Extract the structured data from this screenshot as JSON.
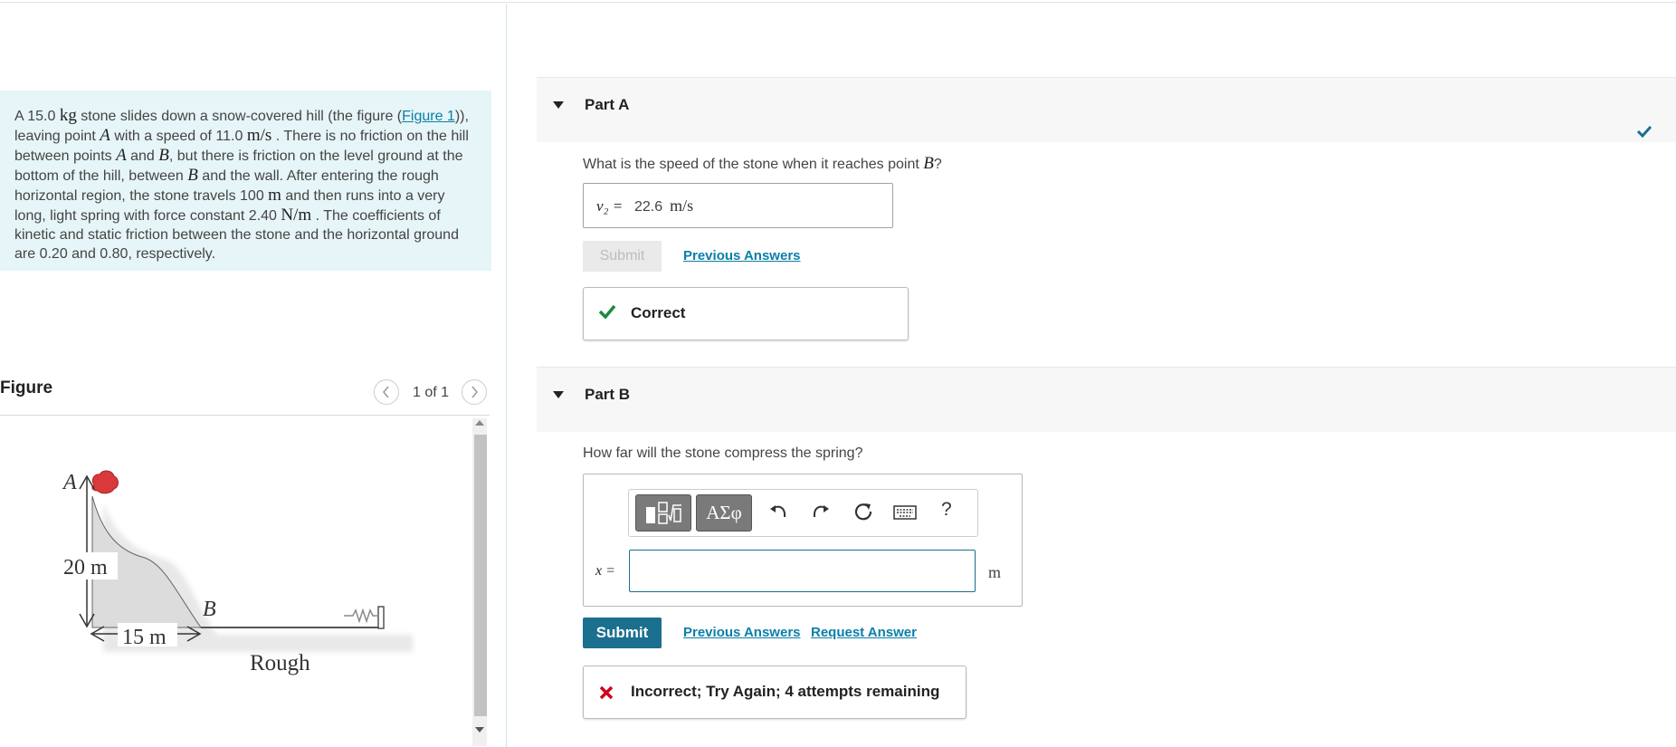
{
  "problem": {
    "t1": "A 15.0 ",
    "kg": "kg",
    "t2": " stone slides down a snow-covered hill (the figure (",
    "figure_link": "Figure 1",
    "t3": ")), leaving point ",
    "A": "A",
    "t4": " with a speed of 11.0 ",
    "ms": "m/s",
    "t5": " . There is no friction on the hill between points ",
    "A2": "A",
    "t6": " and ",
    "B": "B",
    "t7": ", but there is friction on the level ground at the bottom of the hill, between ",
    "B2": "B",
    "t8": " and the wall. After entering the rough horizontal region, the stone travels 100 ",
    "m": "m",
    "t9": " and then runs into a very long, light spring with force constant 2.40 ",
    "Nm": "N/m",
    "t10": " . The coefficients of kinetic and static friction between the stone and the horizontal ground are 0.20 and 0.80, respectively."
  },
  "figure": {
    "title": "Figure",
    "pager": "1 of 1",
    "label_A": "A",
    "label_height": "20 m",
    "label_B": "B",
    "label_width": "15 m",
    "label_rough": "Rough"
  },
  "partA": {
    "title": "Part A",
    "question_pre": "What is the speed of the stone when it reaches point ",
    "question_var": "B",
    "question_post": "?",
    "answer_label": "v₂ =",
    "answer_value": "22.6",
    "answer_unit": "m/s",
    "submit_label": "Submit",
    "prev_answers": "Previous Answers",
    "feedback": "Correct"
  },
  "partB": {
    "title": "Part B",
    "question": "How far will the stone compress the spring?",
    "toolbar_greek": "ΑΣφ",
    "toolbar_help": "?",
    "input_label": "x =",
    "input_unit": "m",
    "submit_label": "Submit",
    "prev_answers": "Previous Answers",
    "request_answer": "Request Answer",
    "feedback": "Incorrect; Try Again; 4 attempts remaining"
  },
  "colors": {
    "accent": "#1b6f8f",
    "link": "#0b7ea7",
    "correct": "#1a8a3c",
    "incorrect": "#d0021b",
    "problem_bg": "#e6f5f7"
  },
  "icons": [
    "triangle-down-icon",
    "check-icon",
    "chevron-left-icon",
    "chevron-right-icon",
    "templates-icon",
    "undo-icon",
    "redo-icon",
    "reset-icon",
    "keyboard-icon",
    "help-icon",
    "x-icon"
  ]
}
